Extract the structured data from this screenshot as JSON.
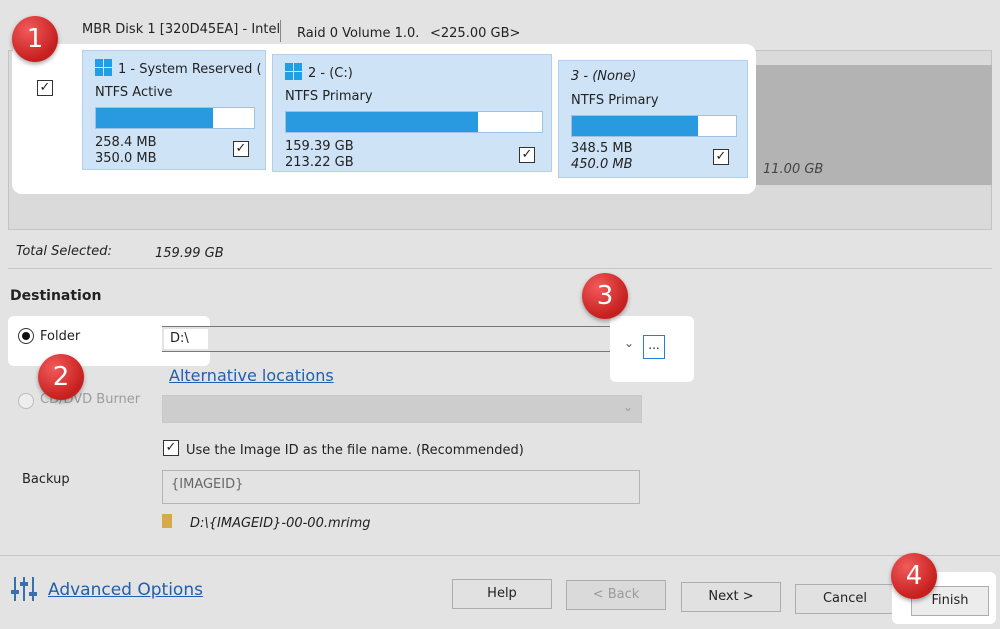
{
  "disk": {
    "title": "MBR Disk 1 [320D45EA] - Intel",
    "raid_label": "Raid 0 Volume 1.0.",
    "raid_size": "<225.00 GB>",
    "unallocated_size": "11.00 GB"
  },
  "partitions": [
    {
      "name": "1 - System Reserved (",
      "type": "NTFS Active",
      "used": "258.4 MB",
      "total": "350.0 MB",
      "fill": 0.74,
      "italic": false,
      "icon": "windows-logo-icon"
    },
    {
      "name": "2 - (C:)",
      "type": "NTFS Primary",
      "used": "159.39 GB",
      "total": "213.22 GB",
      "fill": 0.75,
      "italic": false,
      "icon": "windows-logo-icon"
    },
    {
      "name": "3 - (None)",
      "type": "NTFS Primary",
      "used": "348.5 MB",
      "total": "450.0 MB",
      "fill": 0.77,
      "italic": true,
      "icon": ""
    }
  ],
  "total_selected": {
    "label": "Total Selected:",
    "value": "159.99 GB"
  },
  "destination": {
    "heading": "Destination",
    "folder_label": "Folder",
    "folder_value": "D:\\",
    "browse_label": "...",
    "alt_locations": "Alternative locations",
    "burner_label": "CD/DVD Burner",
    "use_image_id_label": "Use the Image ID as the file name.  (Recommended)",
    "backup_label": "Backup",
    "backup_value": "{IMAGEID}",
    "file_path": "D:\\{IMAGEID}-00-00.mrimg"
  },
  "footer": {
    "advanced_options": "Advanced Options",
    "help": "Help",
    "back": "< Back",
    "next": "Next >",
    "cancel": "Cancel",
    "finish": "Finish"
  },
  "badges": [
    "1",
    "2",
    "3",
    "4"
  ],
  "colors": {
    "accent": "#2a9ae0",
    "badge": "#d62b2b",
    "link": "#1f5fb0",
    "tile": "#cfe3f7"
  }
}
